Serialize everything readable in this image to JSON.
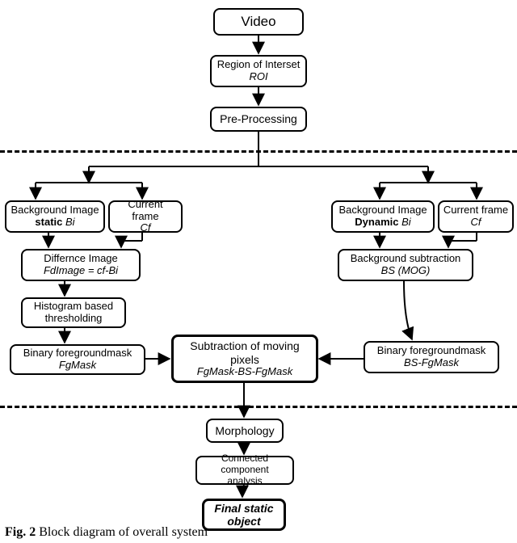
{
  "caption": {
    "fig": "Fig. 2",
    "text": "  Block diagram of overall system"
  },
  "boxes": {
    "video": {
      "l1": "Video"
    },
    "roi": {
      "l1": "Region of Interset",
      "l2": "ROI"
    },
    "preproc": {
      "l1": "Pre-Processing"
    },
    "bgStatic": {
      "l1": "Background Image",
      "tag": "static",
      "sym": "Bi"
    },
    "cfLeft": {
      "l1": "Current frame",
      "l2": "Cf"
    },
    "diff": {
      "l1": "Differnce Image",
      "l2": "FdImage = cf-Bi"
    },
    "hist": {
      "l1": "Histogram based",
      "l2": "thresholding"
    },
    "fgMaskL": {
      "l1": "Binary foregroundmask",
      "l2": "FgMask"
    },
    "bgDyn": {
      "l1": "Background Image",
      "tag": "Dynamic",
      "sym": "Bi"
    },
    "cfRight": {
      "l1": "Current frame",
      "l2": "Cf"
    },
    "bsMog": {
      "l1": "Background subtraction",
      "l2": "BS (MOG)"
    },
    "fgMaskR": {
      "l1": "Binary foregroundmask",
      "l2": "BS-FgMask"
    },
    "subMoving": {
      "l1": "Subtraction of moving",
      "l2": "pixels",
      "l3": "FgMask-BS-FgMask"
    },
    "morph": {
      "l1": "Morphology"
    },
    "cca": {
      "l1": "Connected component",
      "l2": "analysis"
    },
    "final": {
      "l1": "Final static",
      "l2": "object"
    }
  }
}
